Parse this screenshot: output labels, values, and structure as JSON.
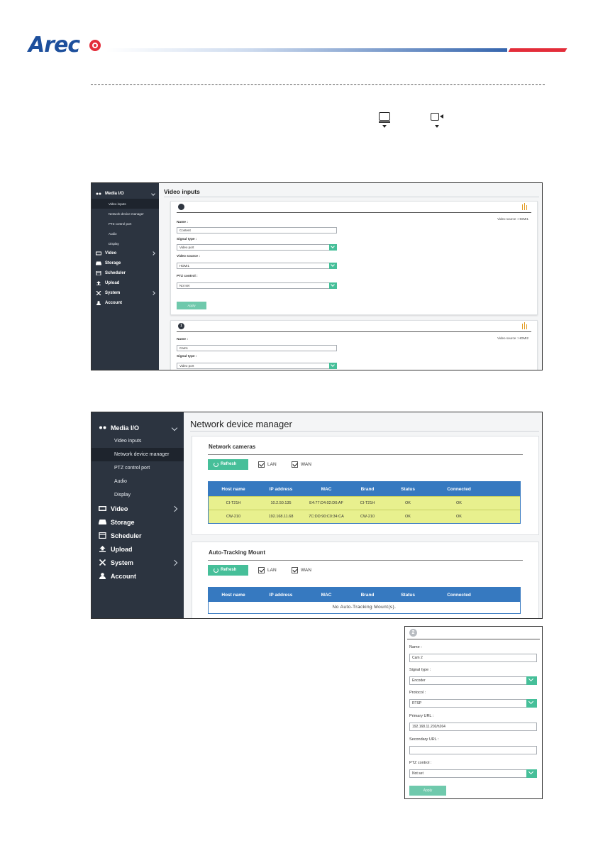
{
  "brand": {
    "logo_text": "Arec",
    "accent_blue": "#1d4f9c",
    "accent_red": "#e32d3a"
  },
  "symbols": [
    "computer-input-icon",
    "camera-input-icon"
  ],
  "sidebar": {
    "media_io": "Media I/O",
    "sub_items": [
      "Video inputs",
      "Network device manager",
      "PTZ control port",
      "Audio",
      "Display"
    ],
    "video": "Video",
    "storage": "Storage",
    "scheduler": "Scheduler",
    "upload": "Upload",
    "system": "System",
    "account": "Account"
  },
  "video_inputs": {
    "title": "Video inputs",
    "cards": [
      {
        "number": "",
        "source_text": "Video source :  HDMI1",
        "name_label": "Name :",
        "name_value": "Content",
        "signal_label": "Signal type :",
        "signal_value": "Video port",
        "video_source_label": "Video source :",
        "video_source_value": "HDMI1",
        "ptz_label": "PTZ control :",
        "ptz_value": "Not set",
        "apply_label": "Apply"
      },
      {
        "number": "1",
        "source_text": "Video source :  HDMI2",
        "name_label": "Name :",
        "name_value": "Cam1",
        "signal_label": "Signal type :",
        "signal_value": "Video port"
      }
    ]
  },
  "network_device_manager": {
    "title": "Network device manager",
    "cameras": {
      "title": "Network cameras",
      "refresh_label": "Refresh",
      "lan_label": "LAN",
      "wan_label": "WAN",
      "columns": [
        "Host name",
        "IP address",
        "MAC",
        "Brand",
        "Status",
        "Connected"
      ],
      "rows": [
        [
          "CI-T21H",
          "10.2.50.135",
          "E4:77:D4:02:D0:AF",
          "CI-T21H",
          "OK",
          "OK"
        ],
        [
          "CW-210",
          "192.168.11.68",
          "7C:DD:90:C0:34:CA",
          "CW-210",
          "OK",
          "OK"
        ]
      ]
    },
    "tracking": {
      "title": "Auto-Tracking Mount",
      "refresh_label": "Refresh",
      "lan_label": "LAN",
      "wan_label": "WAN",
      "columns": [
        "Host name",
        "IP address",
        "MAC",
        "Brand",
        "Status",
        "Connected"
      ],
      "empty_text": "No Auto-Tracking Mount(s)."
    }
  },
  "edit_form": {
    "number": "2",
    "name_label": "Name :",
    "name_value": "Cam 2",
    "signal_label": "Signal type :",
    "signal_value": "Encoder",
    "protocol_label": "Protocol :",
    "protocol_value": "RTSP",
    "primary_label": "Primary URL :",
    "primary_value": "192.168.11.202/h264",
    "secondary_label": "Secondary URL :",
    "secondary_value": "",
    "ptz_label": "PTZ control :",
    "ptz_value": "Not set",
    "apply_label": "Apply"
  }
}
